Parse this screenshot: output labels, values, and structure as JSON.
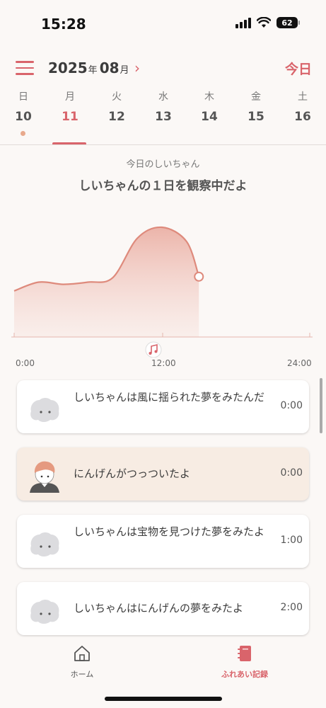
{
  "status_bar": {
    "time": "15:28",
    "battery": "62"
  },
  "header": {
    "year": "2025",
    "year_unit": "年",
    "month": "08",
    "month_unit": "月",
    "today_label": "今日"
  },
  "week": [
    {
      "dow": "日",
      "num": "10",
      "has_dot": true
    },
    {
      "dow": "月",
      "num": "11",
      "selected": true
    },
    {
      "dow": "火",
      "num": "12"
    },
    {
      "dow": "水",
      "num": "13"
    },
    {
      "dow": "木",
      "num": "14"
    },
    {
      "dow": "金",
      "num": "15"
    },
    {
      "dow": "土",
      "num": "16"
    }
  ],
  "chart_section": {
    "subtitle": "今日のしいちゃん",
    "title": "しいちゃんの１日を観察中だよ"
  },
  "chart_data": {
    "type": "area",
    "x": [
      0,
      2,
      4,
      6,
      8,
      10,
      12,
      14,
      15
    ],
    "values": [
      0.42,
      0.5,
      0.48,
      0.5,
      0.54,
      0.9,
      1.0,
      0.87,
      0.55
    ],
    "xlim": [
      0,
      24
    ],
    "ylim": [
      0,
      1.2
    ],
    "x_ticks": [
      "0:00",
      "12:00",
      "24:00"
    ],
    "fill_color": "#eaa99e",
    "line_color": "#de8a7c",
    "current_marker": true
  },
  "records": [
    {
      "text": "しいちゃんは風に揺られた夢をみたんだ",
      "time": "0:00",
      "avatar": "ghost-avatar",
      "highlight": false
    },
    {
      "text": "にんげんがつっついたよ",
      "time": "0:00",
      "avatar": "human-avatar",
      "highlight": true
    },
    {
      "text": "しいちゃんは宝物を見つけた夢をみたよ",
      "time": "1:00",
      "avatar": "ghost-avatar",
      "highlight": false
    },
    {
      "text": "しいちゃんはにんげんの夢をみたよ",
      "time": "2:00",
      "avatar": "ghost-avatar",
      "highlight": false
    }
  ],
  "bottom_nav": {
    "home": {
      "label": "ホーム",
      "icon": "home-icon"
    },
    "records": {
      "label": "ふれあい記録",
      "icon": "notebook-icon",
      "active": true
    }
  },
  "colors": {
    "accent": "#d9646b",
    "background": "#fbf8f6",
    "highlight_card": "#f7ece3"
  }
}
